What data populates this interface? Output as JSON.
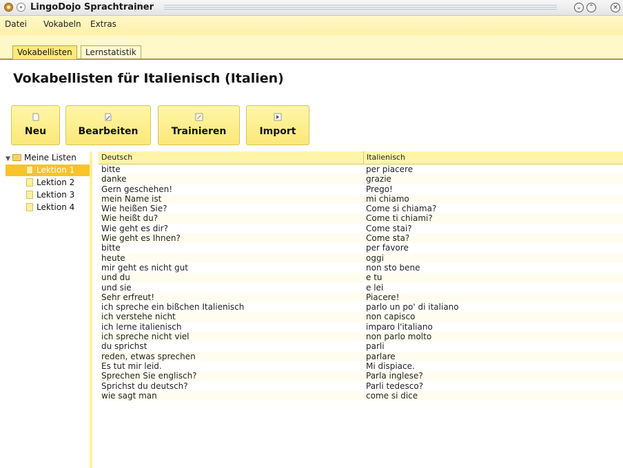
{
  "window": {
    "title": "LingoDojo Sprachtrainer"
  },
  "menu": [
    "Datei",
    "Vokabeln",
    "Extras"
  ],
  "tabs": [
    {
      "label": "Vokabellisten",
      "active": true
    },
    {
      "label": "Lernstatistik",
      "active": false
    }
  ],
  "heading": "Vokabellisten für Italienisch (Italien)",
  "toolbar": {
    "new": {
      "label": "Neu",
      "icon": "new-document-icon"
    },
    "edit": {
      "label": "Bearbeiten",
      "icon": "edit-icon"
    },
    "train": {
      "label": "Trainieren",
      "icon": "train-icon"
    },
    "import": {
      "label": "Import",
      "icon": "import-icon"
    }
  },
  "tree": {
    "root": "Meine Listen",
    "items": [
      "Lektion 1",
      "Lektion 2",
      "Lektion 3",
      "Lektion 4"
    ],
    "selected_index": 0
  },
  "table": {
    "headers": {
      "deutsch": "Deutsch",
      "italienisch": "Italienisch"
    },
    "rows": [
      [
        "bitte",
        "per piacere"
      ],
      [
        "danke",
        "grazie"
      ],
      [
        "Gern geschehen!",
        "Prego!"
      ],
      [
        "mein Name ist",
        "mi chiamo"
      ],
      [
        "Wie heißen Sie?",
        "Come si chiama?"
      ],
      [
        "Wie heißt du?",
        "Come ti chiami?"
      ],
      [
        "Wie geht es dir?",
        "Come stai?"
      ],
      [
        "Wie geht es Ihnen?",
        "Come sta?"
      ],
      [
        "bitte",
        "per favore"
      ],
      [
        "heute",
        "oggi"
      ],
      [
        "mir geht es nicht gut",
        "non sto bene"
      ],
      [
        "und du",
        "e tu"
      ],
      [
        "und sie",
        "e lei"
      ],
      [
        "Sehr erfreut!",
        "Piacere!"
      ],
      [
        "ich spreche ein bißchen Italienisch",
        "parlo un po' di italiano"
      ],
      [
        "ich verstehe nicht",
        "non capisco"
      ],
      [
        "ich lerne italienisch",
        "imparo l'italiano"
      ],
      [
        "ich spreche nicht viel",
        "non parlo molto"
      ],
      [
        "du sprichst",
        "parli"
      ],
      [
        "reden, etwas sprechen",
        "parlare"
      ],
      [
        "Es tut mir leid.",
        "Mi dispiace."
      ],
      [
        "Sprechen Sie englisch?",
        "Parla inglese?"
      ],
      [
        "Sprichst du deutsch?",
        "Parli tedesco?"
      ],
      [
        "wie sagt man",
        "come si dice"
      ]
    ]
  },
  "colors": {
    "accent": "#f9c32a",
    "menubar": "#fff1a8",
    "button": "#fbe878"
  }
}
